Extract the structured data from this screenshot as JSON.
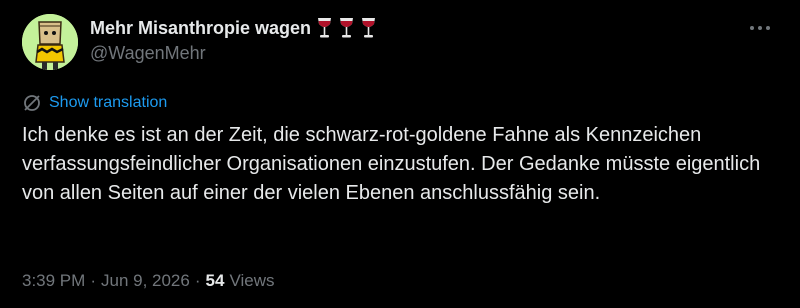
{
  "colors": {
    "background": "#000000",
    "text_primary": "#e7e9ea",
    "text_secondary": "#71767b",
    "link": "#1d9bf0",
    "avatar_background": "#c4f19a"
  },
  "author": {
    "display_name": "Mehr Misanthropie wagen",
    "emoji_icons": [
      "wine-glass-icon",
      "wine-glass-icon",
      "wine-glass-icon"
    ],
    "handle": "@WagenMehr",
    "avatar_icon": "cartoon-character-paper-bag-avatar"
  },
  "header": {
    "more_icon": "more-horizontal-icon"
  },
  "translation": {
    "icon": "translate-icon",
    "label": "Show translation"
  },
  "tweet": {
    "text": "Ich denke es ist an der Zeit, die schwarz-rot-goldene Fahne als Kennzeichen verfassungsfeindlicher Organisationen einzustufen. Der Gedanke müsste eigentlich von allen Seiten auf einer der vielen Ebenen anschlussfähig sein."
  },
  "meta": {
    "time": "3:39 PM",
    "separator": "·",
    "date": "Jun 9, 2026",
    "views_count": "54",
    "views_label": "Views"
  }
}
